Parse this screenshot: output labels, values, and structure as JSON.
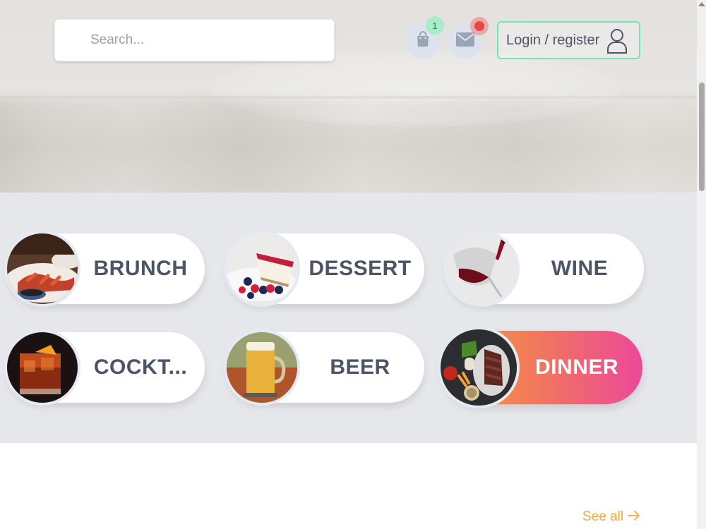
{
  "header": {
    "search": {
      "placeholder": "Search..."
    },
    "cart": {
      "count": "1"
    },
    "login": {
      "label": "Login / register"
    }
  },
  "categories": [
    {
      "label": "BRUNCH",
      "icon": "brunch-photo"
    },
    {
      "label": "DESSERT",
      "icon": "dessert-photo"
    },
    {
      "label": "WINE",
      "icon": "wine-photo"
    },
    {
      "label": "COCKT...",
      "icon": "cocktail-photo"
    },
    {
      "label": "BEER",
      "icon": "beer-photo"
    },
    {
      "label": "DINNER",
      "icon": "dinner-photo",
      "active": true
    }
  ],
  "section": {
    "see_all": "See all"
  },
  "colors": {
    "accent_green": "#6ee7b7",
    "accent_orange": "#f59e3b",
    "accent_pink": "#ec4899",
    "notification_red": "#ef4444"
  }
}
